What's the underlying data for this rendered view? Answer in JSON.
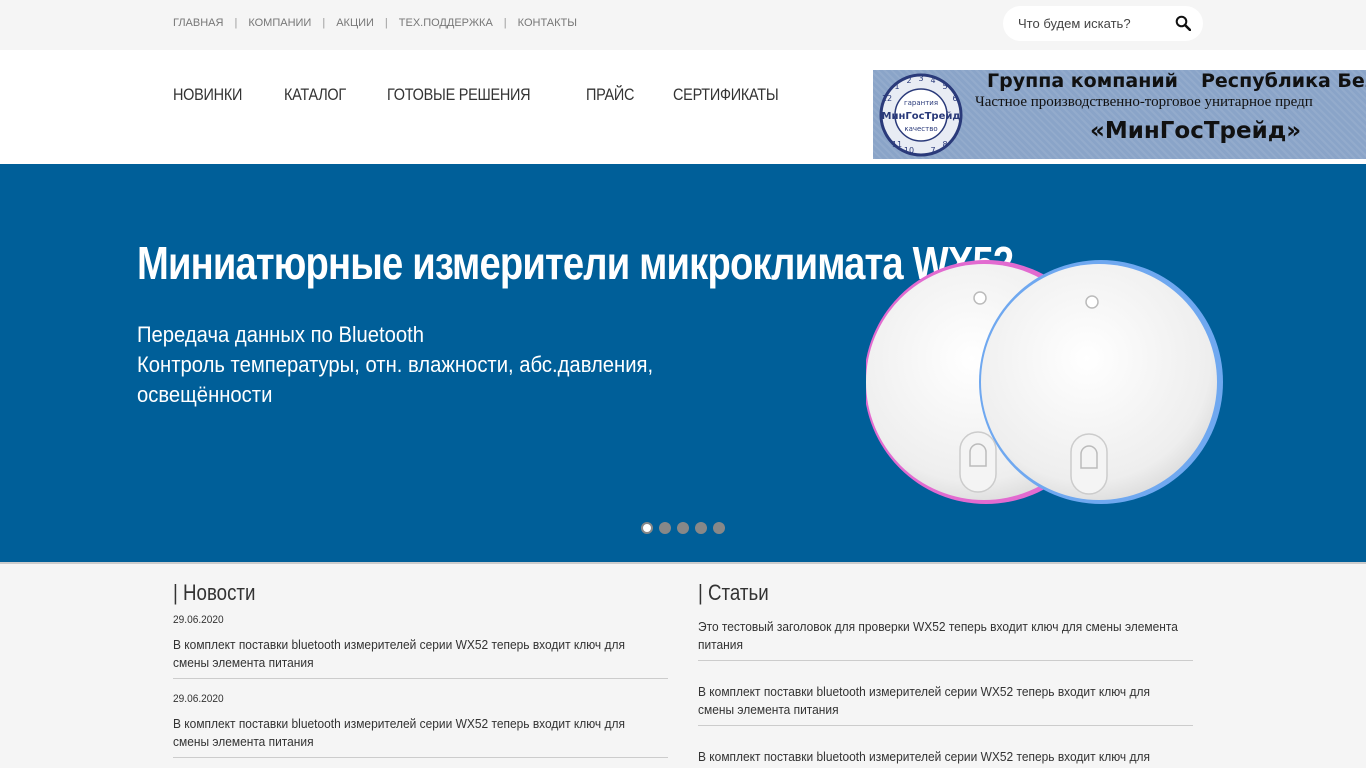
{
  "topnav": {
    "items": [
      "ГЛАВНАЯ",
      "КОМПАНИИ",
      "АКЦИИ",
      "ТЕХ.ПОДДЕРЖКА",
      "КОНТАКТЫ"
    ],
    "separator": "|"
  },
  "search": {
    "placeholder": "Что будем искать?"
  },
  "mainnav": {
    "items": [
      "НОВИНКИ",
      "КАТАЛОГ",
      "ГОТОВЫЕ РЕШЕНИЯ",
      "ПРАЙС",
      "СЕРТИФИКАТЫ"
    ]
  },
  "banner": {
    "line1a": "Группа компаний",
    "line1b": "Республика Бела",
    "line2": "Частное производственно-торговое унитарное предп",
    "line3": "«МинГосТрейд»",
    "seal_top": "гарантия",
    "seal_mid": "МинГосТрейд",
    "seal_bottom": "качество"
  },
  "hero": {
    "title": "Миниатюрные измерители микроклимата WX52",
    "sub1": "Передача данных по Bluetooth",
    "sub2": "Контроль температуры, отн. влажности, абс.давления,",
    "sub3": "освещённости",
    "slides": 5,
    "active_slide": 1
  },
  "news": {
    "title": "| Новости",
    "items": [
      {
        "date": "29.06.2020",
        "text": "В комплект поставки bluetooth измерителей серии WX52 теперь входит ключ для смены элемента питания"
      },
      {
        "date": "29.06.2020",
        "text": "В комплект поставки bluetooth измерителей серии WX52 теперь входит ключ для смены элемента питания"
      }
    ]
  },
  "articles": {
    "title": "| Статьи",
    "items": [
      {
        "text": "Это тестовый заголовок для проверки WX52 теперь входит ключ для смены элемента питания"
      },
      {
        "text": "В комплект поставки bluetooth измерителей серии WX52 теперь входит ключ для смены элемента питания"
      },
      {
        "text": "В комплект поставки bluetooth измерителей серии WX52 теперь входит ключ для смены элемента питания"
      }
    ]
  },
  "colors": {
    "hero_bg": "#005f99",
    "page_bg": "#f5f5f5",
    "text": "#333333"
  }
}
